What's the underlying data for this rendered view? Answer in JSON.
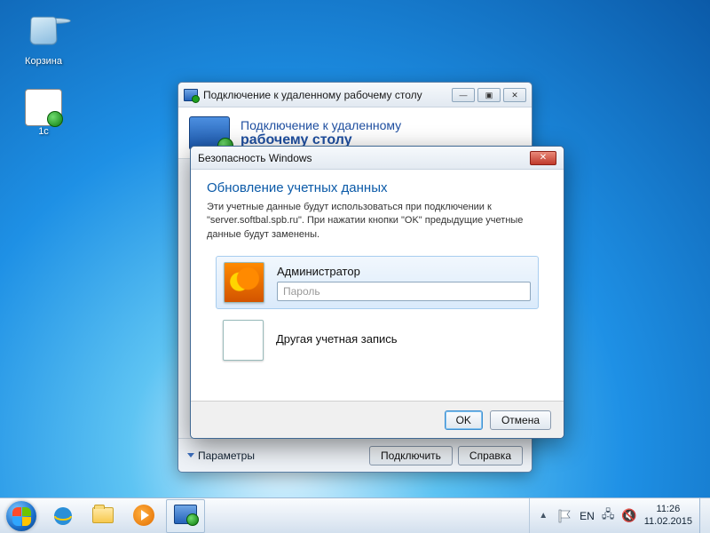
{
  "desktop": {
    "icons": [
      {
        "name": "recycle-bin",
        "label": "Корзина"
      },
      {
        "name": "onec",
        "label": "1с"
      }
    ]
  },
  "rdc_window": {
    "title": "Подключение к удаленному рабочему столу",
    "banner_line1": "Подключение к удаленному",
    "banner_line2": "рабочему столу",
    "options_label": "Параметры",
    "connect_label": "Подключить",
    "help_label": "Справка"
  },
  "security_dialog": {
    "title": "Безопасность Windows",
    "heading": "Обновление учетных данных",
    "body": "Эти учетные данные будут использоваться при подключении к \"server.softbal.spb.ru\". При нажатии кнопки \"OK\" предыдущие учетные данные будут заменены.",
    "accounts": [
      {
        "name": "Администратор",
        "password_placeholder": "Пароль",
        "selected": true,
        "avatar": "flower"
      },
      {
        "name": "Другая учетная запись",
        "selected": false,
        "avatar": "blank"
      }
    ],
    "ok_label": "OK",
    "cancel_label": "Отмена"
  },
  "taskbar": {
    "lang": "EN",
    "time": "11:26",
    "date": "11.02.2015"
  }
}
